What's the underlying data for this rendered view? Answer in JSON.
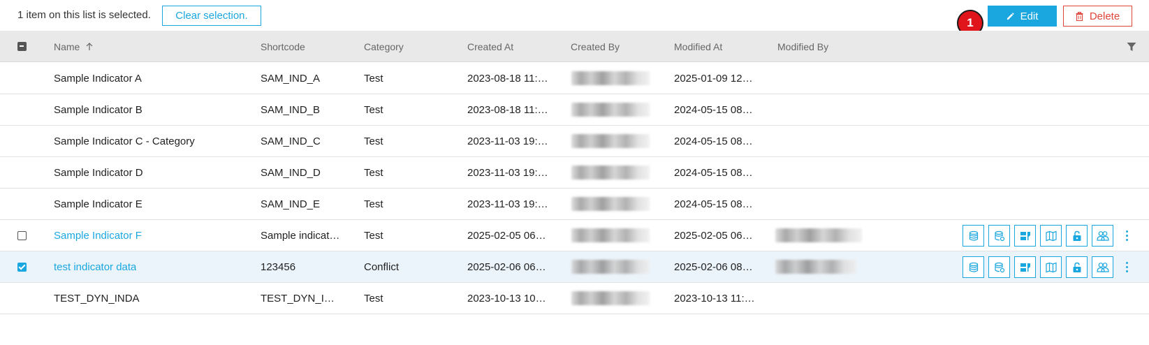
{
  "selection": {
    "status_text": "1 item on this list is selected.",
    "clear_label": "Clear selection."
  },
  "toolbar": {
    "edit_label": "Edit",
    "delete_label": "Delete",
    "step_badge": "1",
    "edit_icon": "pencil-icon",
    "delete_icon": "trash-icon"
  },
  "table": {
    "columns": [
      "Name",
      "Shortcode",
      "Category",
      "Created At",
      "Created By",
      "Modified At",
      "Modified By"
    ],
    "sort_column": "Name",
    "sort_direction": "ascending",
    "rows": [
      {
        "name": "Sample Indicator A",
        "shortcode": "SAM_IND_A",
        "category": "Test",
        "created_at": "2023-08-18 11:…",
        "modified_at": "2025-01-09 12…"
      },
      {
        "name": "Sample Indicator B",
        "shortcode": "SAM_IND_B",
        "category": "Test",
        "created_at": "2023-08-18 11:…",
        "modified_at": "2024-05-15 08…"
      },
      {
        "name": "Sample Indicator C - Category",
        "shortcode": "SAM_IND_C",
        "category": "Test",
        "created_at": "2023-11-03 19:…",
        "modified_at": "2024-05-15 08…"
      },
      {
        "name": "Sample Indicator D",
        "shortcode": "SAM_IND_D",
        "category": "Test",
        "created_at": "2023-11-03 19:…",
        "modified_at": "2024-05-15 08…"
      },
      {
        "name": "Sample Indicator E",
        "shortcode": "SAM_IND_E",
        "category": "Test",
        "created_at": "2023-11-03 19:…",
        "modified_at": "2024-05-15 08…"
      },
      {
        "name": "Sample Indicator F",
        "shortcode": "Sample indicat…",
        "category": "Test",
        "created_at": "2025-02-05 06…",
        "modified_at": "2025-02-05 06…"
      },
      {
        "name": "test indicator data",
        "shortcode": "123456",
        "category": "Conflict",
        "created_at": "2025-02-06 06…",
        "modified_at": "2025-02-06 08…"
      },
      {
        "name": "TEST_DYN_INDA",
        "shortcode": "TEST_DYN_I…",
        "category": "Test",
        "created_at": "2023-10-13 10…",
        "modified_at": "2023-10-13 11:…"
      }
    ],
    "row_actions": [
      "database-icon",
      "database-settings-icon",
      "data-link-icon",
      "map-icon",
      "unlock-icon",
      "users-icon",
      "more-vertical-icon"
    ]
  },
  "colors": {
    "accent": "#1aa7e0",
    "danger": "#e0453a",
    "header_bg": "#e9e9e9",
    "selected_row_bg": "#ebf4fb",
    "badge": "#e0151b"
  }
}
